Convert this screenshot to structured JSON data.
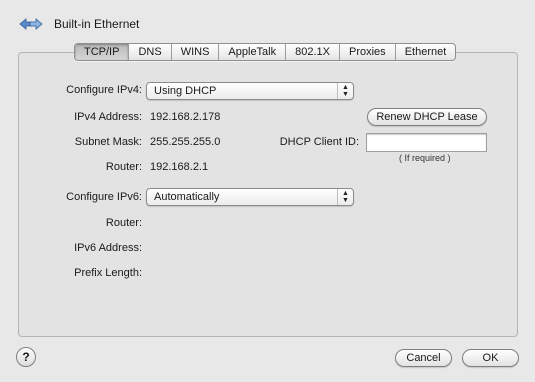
{
  "window": {
    "title": "Built-in Ethernet"
  },
  "tabs": [
    {
      "label": "TCP/IP",
      "active": true
    },
    {
      "label": "DNS"
    },
    {
      "label": "WINS"
    },
    {
      "label": "AppleTalk"
    },
    {
      "label": "802.1X"
    },
    {
      "label": "Proxies"
    },
    {
      "label": "Ethernet"
    }
  ],
  "ipv4": {
    "configure_label": "Configure IPv4:",
    "configure_value": "Using DHCP",
    "address_label": "IPv4 Address:",
    "address_value": "192.168.2.178",
    "subnet_label": "Subnet Mask:",
    "subnet_value": "255.255.255.0",
    "router_label": "Router:",
    "router_value": "192.168.2.1",
    "renew_button": "Renew DHCP Lease",
    "client_id_label": "DHCP Client ID:",
    "client_id_value": "",
    "client_id_hint": "( If required )"
  },
  "ipv6": {
    "configure_label": "Configure IPv6:",
    "configure_value": "Automatically",
    "router_label": "Router:",
    "address_label": "IPv6 Address:",
    "prefix_label": "Prefix Length:"
  },
  "footer": {
    "help_label": "?",
    "cancel_label": "Cancel",
    "ok_label": "OK"
  },
  "icons": {
    "network": "network-arrows-icon",
    "popup_arrows": "popup-arrows-icon"
  },
  "colors": {
    "background": "#e8e8e8",
    "panel": "#e3e3e3"
  }
}
